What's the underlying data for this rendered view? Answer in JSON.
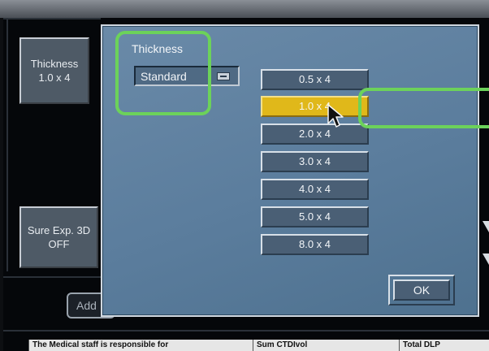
{
  "side_panel": {
    "thickness_button": {
      "line1": "Thickness",
      "line2": "1.0 x 4"
    },
    "sure_exp_button": {
      "line1": "Sure Exp. 3D",
      "line2": "OFF"
    }
  },
  "add_button_label": "Add",
  "dialog": {
    "title": "Thickness",
    "mode_select": {
      "value": "Standard",
      "icon": "dropdown-icon"
    },
    "options": [
      "0.5 x 4",
      "1.0 x 4",
      "2.0 x 4",
      "3.0 x 4",
      "4.0 x 4",
      "5.0 x 4",
      "8.0 x 4"
    ],
    "selected_option": "1.0 x 4",
    "ok_label": "OK"
  },
  "status_bar": {
    "cell1": "The Medical staff is responsible for",
    "cell2": "Sum CTDIvol",
    "cell3": "Total DLP"
  },
  "colors": {
    "dialog_bg": "#5b7d9d",
    "selected_option": "#e0b81a",
    "highlight_annotation": "#6cd25a"
  }
}
